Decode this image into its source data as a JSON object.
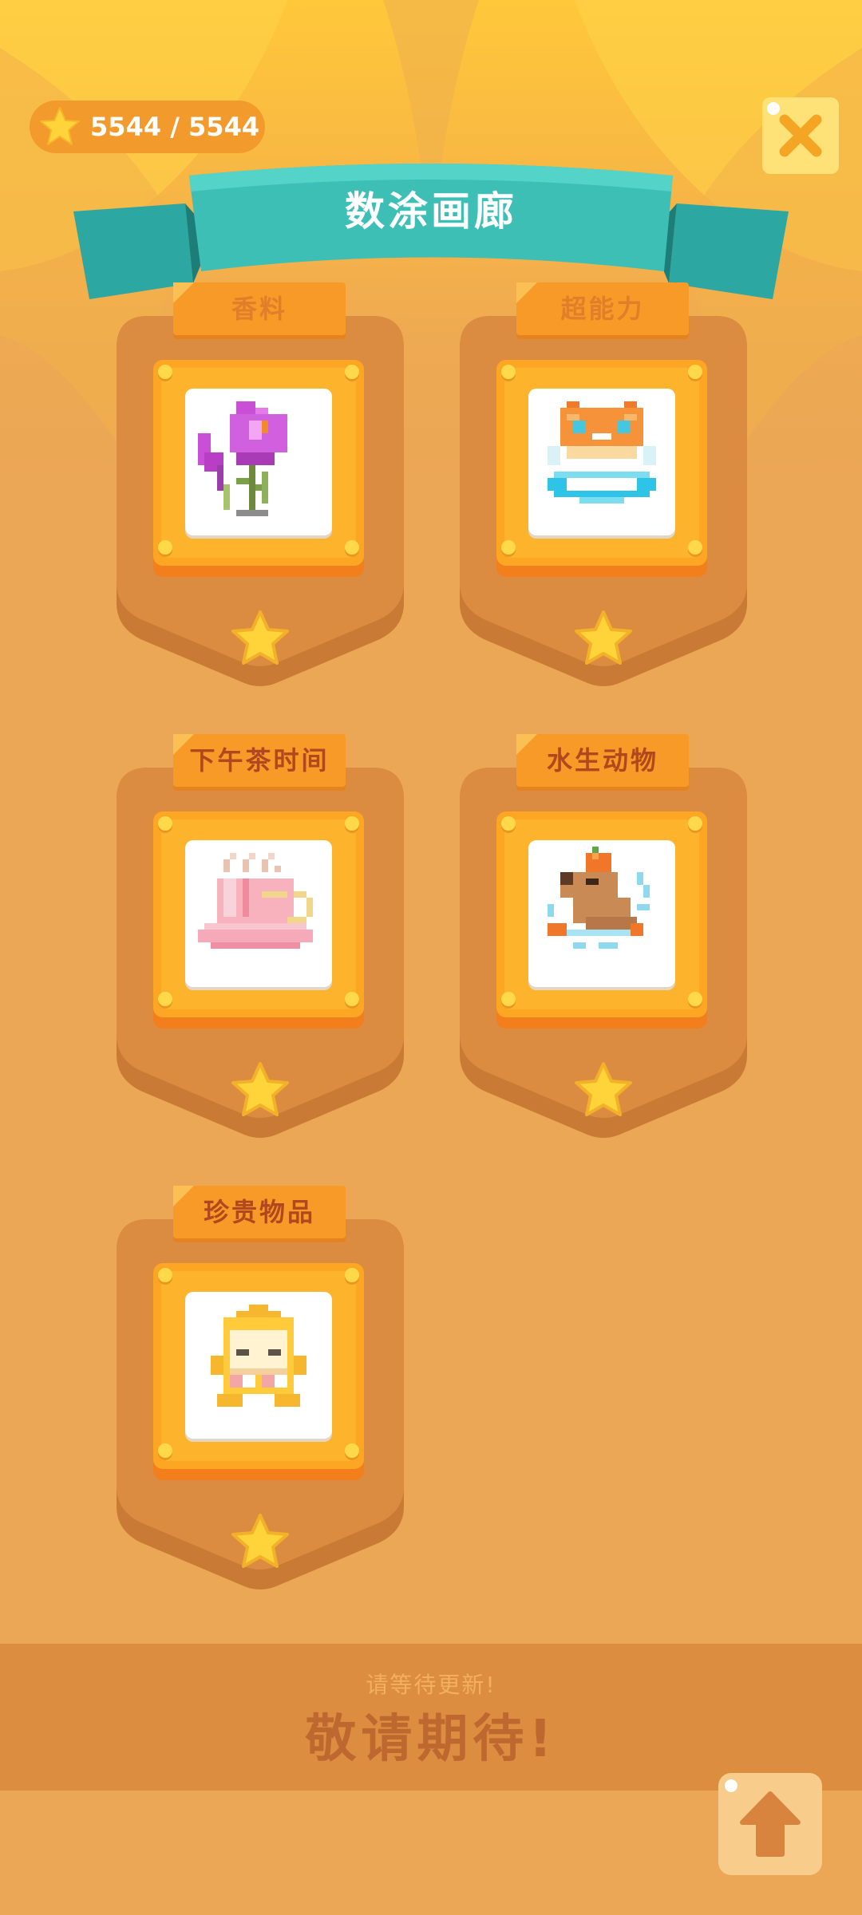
{
  "header": {
    "stars": "5544 / 5544",
    "title": "数涂画廊",
    "close_icon": "close-icon"
  },
  "gallery": {
    "items": [
      {
        "label": "香料",
        "picture": "crocus-flower-pixel-art",
        "unlocked_style": "dim"
      },
      {
        "label": "超能力",
        "picture": "cat-halo-pixel-art",
        "unlocked_style": "dim"
      },
      {
        "label": "下午茶时间",
        "picture": "teacup-pixel-art",
        "unlocked_style": "strong"
      },
      {
        "label": "水生动物",
        "picture": "capybara-orange-pixel-art",
        "unlocked_style": "strong"
      },
      {
        "label": "珍贵物品",
        "picture": "hooded-figure-pixel-art",
        "unlocked_style": "strong"
      }
    ]
  },
  "footer": {
    "notice_sub": "请等待更新!",
    "notice_main": "敬请期待!",
    "scroll_top_icon": "arrow-up-icon"
  },
  "colors": {
    "background": "#EBA656",
    "card": "#DB8C40",
    "frame": "#FCA624",
    "ribbon": "#37B5AD",
    "star": "#FFD33A"
  }
}
